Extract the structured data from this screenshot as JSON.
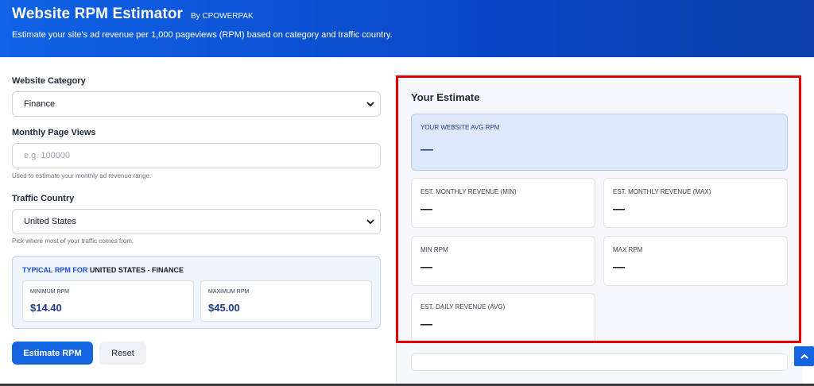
{
  "header": {
    "title": "Website RPM Estimator",
    "byline": "By CPOWERPAK",
    "subtitle": "Estimate your site's ad revenue per 1,000 pageviews (RPM) based on category and traffic country."
  },
  "form": {
    "category_label": "Website Category",
    "category_value": "Finance",
    "pageviews_label": "Monthly Page Views",
    "pageviews_placeholder": "e.g. 100000",
    "pageviews_help": "Used to estimate your monthly ad revenue range.",
    "country_label": "Traffic Country",
    "country_value": "United States",
    "country_help": "Pick where most of your traffic comes from."
  },
  "typical": {
    "prefix": "TYPICAL RPM FOR",
    "selection": "UNITED STATES - FINANCE",
    "min_label": "MINIMUM RPM",
    "min_value": "$14.40",
    "max_label": "MAXIMUM RPM",
    "max_value": "$45.00"
  },
  "buttons": {
    "estimate": "Estimate RPM",
    "reset": "Reset"
  },
  "estimate": {
    "title": "Your Estimate",
    "avg_label": "YOUR WEBSITE AVG RPM",
    "avg_value": "—",
    "monthly_min_label": "EST. MONTHLY REVENUE (MIN)",
    "monthly_min_value": "—",
    "monthly_max_label": "EST. MONTHLY REVENUE (MAX)",
    "monthly_max_value": "—",
    "min_rpm_label": "MIN RPM",
    "min_rpm_value": "—",
    "max_rpm_label": "MAX RPM",
    "max_rpm_value": "—",
    "daily_label": "EST. DAILY REVENUE (AVG)",
    "daily_value": "—"
  },
  "colors": {
    "primary": "#1565e0",
    "highlight": "#e40000",
    "accent_text": "#1e3a8a"
  },
  "icons": {
    "select_chevron": "chevron-down-icon",
    "scroll_top": "chevron-up-icon"
  }
}
